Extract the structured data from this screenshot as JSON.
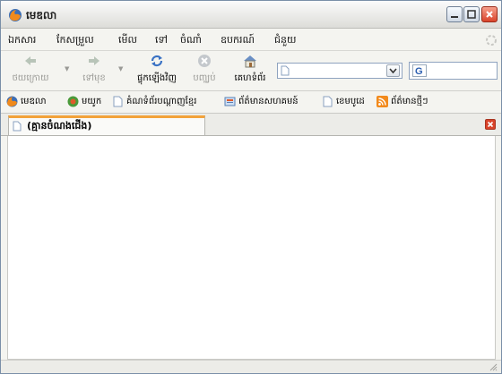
{
  "window": {
    "title": "មេឌលា",
    "title_icon": "firefox-logo-icon",
    "controls": [
      "minimize-icon",
      "maximize-icon",
      "close-icon"
    ]
  },
  "menu": {
    "items": [
      {
        "label": "ឯកសារ"
      },
      {
        "label": "កែសម្រួល"
      },
      {
        "label": "មើល"
      },
      {
        "label": "ទៅ"
      },
      {
        "label": "ចំណាំ"
      },
      {
        "label": "ឧបករណ៍"
      },
      {
        "label": "ជំនួយ"
      }
    ]
  },
  "navbar": {
    "back_label": "ថយក្រោយ",
    "forward_label": "ទៅមុខ",
    "reload_label": "ផ្ទុកឡើងវិញ",
    "stop_label": "បញ្ឈប់",
    "home_label": "គេហទំព័រ",
    "url_value": "",
    "search_value": ""
  },
  "bookmarks": {
    "items": [
      {
        "label": "មេឌលា",
        "icon": "firefox-icon"
      },
      {
        "label": "មយូក",
        "icon": "mozilla-icon"
      },
      {
        "label": "គំណទំព័របណ្តាញខ្មែរ",
        "icon": "page-icon"
      },
      {
        "label": "ព័ត៌មានសហគមន៍",
        "icon": "news-icon"
      },
      {
        "label": "ខេមបូដេ",
        "icon": "page-icon"
      },
      {
        "label": "ព័ត៌មានថ្មីៗ",
        "icon": "rss-feed-icon"
      }
    ]
  },
  "tabs": {
    "items": [
      {
        "label": "(គ្មានចំណងជើង)",
        "active": true
      }
    ]
  },
  "colors": {
    "active_tab_accent": "#f2a23a",
    "close_button": "#d9432a",
    "window_border": "#7a8fa8"
  }
}
